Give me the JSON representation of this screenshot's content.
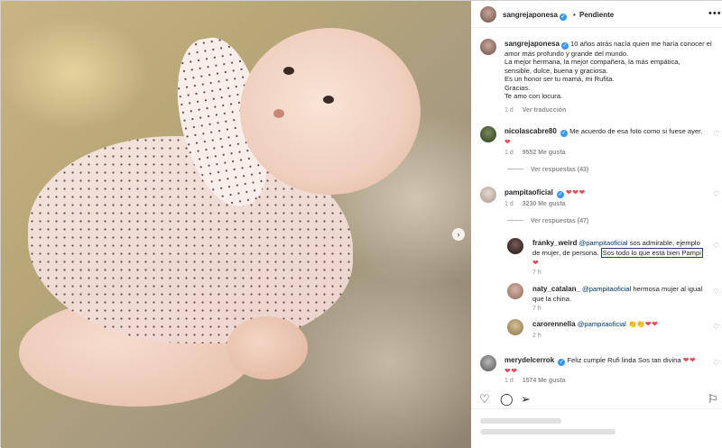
{
  "post": {
    "author": "sangrejaponesa",
    "status": "Pendiente",
    "dot": "•",
    "more_icon": "more-horizontal-icon"
  },
  "caption": {
    "author": "sangrejaponesa",
    "lines": [
      "10 años atrás nacía quien me haría conocer el",
      "amor más profundo y grande del mundo.",
      "La mejor hermana, la mejor compañera, la más empática,",
      "sensible, dulce, buena y graciosa.",
      "Es un honor ser tu mamá, mi Rufita.",
      "Gracias.",
      "Te amo con locura."
    ],
    "time": "1 d",
    "translate": "Ver traducción"
  },
  "comments": [
    {
      "user": "nicolascabre80",
      "text": "Me acuerdo de esa foto como si fuese ayer.",
      "hearts": "❤",
      "time": "1 d",
      "likes": "9552 Me gusta",
      "replies": "Ver respuestas (43)"
    },
    {
      "user": "pampitaoficial",
      "hearts": "❤❤❤",
      "time": "1 d",
      "likes": "3230 Me gusta",
      "replies": "Ver respuestas (47)"
    }
  ],
  "replies": [
    {
      "user": "franky_weird",
      "mention": "@pampitaoficial",
      "text_a": "sos admirable, ejemplo",
      "text_b": "de mujer, de persona.",
      "highlight": "Sos todo lo que está bien Pampi",
      "hearts": "❤",
      "time": "7 h"
    },
    {
      "user": "naty_catalan_",
      "mention": "@pampitaoficial",
      "text_a": "hermosa mujer al igual",
      "text_b": "que la china.",
      "time": "7 h"
    },
    {
      "user": "carorennella",
      "mention": "@pampitaoficial",
      "emojis": "👏👏",
      "hearts": "❤❤",
      "time": "2 h"
    }
  ],
  "last_comment": {
    "user": "merydelcerrok",
    "text": "Feliz cumple Rufi linda Sos tan divina",
    "hearts_a": "❤❤",
    "hearts_b": "❤❤",
    "time": "1 d",
    "likes": "1574 Me gusta"
  },
  "actions": {
    "like": "♡",
    "comment": "◯",
    "share": "➢",
    "save": "⚐"
  },
  "nav": {
    "next": "›"
  },
  "colors": {
    "heart": "#ed4956",
    "verified": "#3897f0",
    "mention": "#00376b"
  }
}
